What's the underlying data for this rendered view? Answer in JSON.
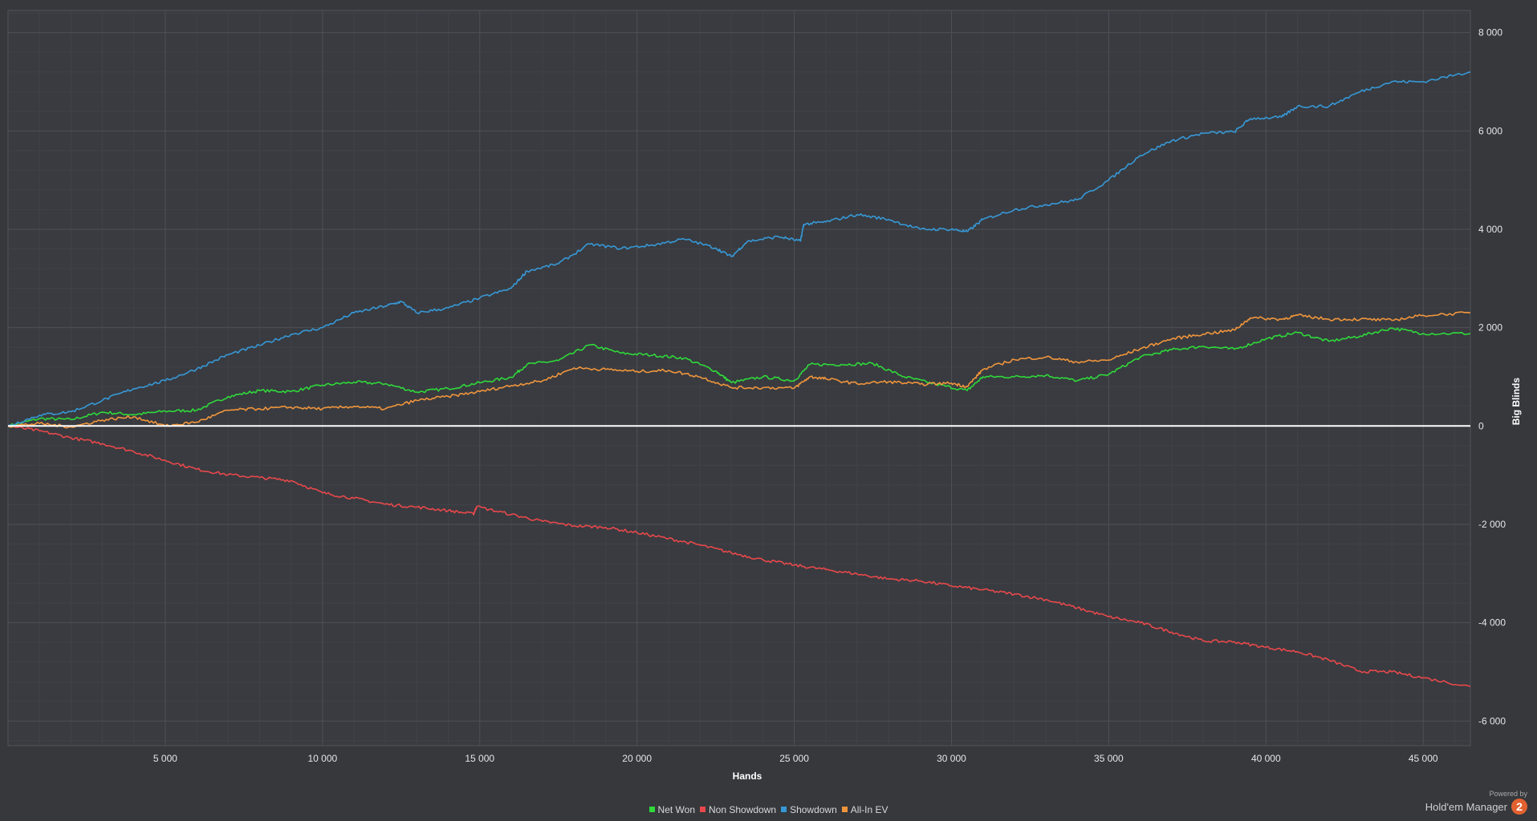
{
  "chart_data": {
    "type": "line",
    "title": "",
    "xlabel": "Hands",
    "ylabel": "Big Blinds",
    "xlim": [
      0,
      46500
    ],
    "ylim": [
      -6500,
      8450
    ],
    "x_ticks": [
      5000,
      10000,
      15000,
      20000,
      25000,
      30000,
      35000,
      40000,
      45000
    ],
    "x_tick_labels": [
      "5 000",
      "10 000",
      "15 000",
      "20 000",
      "25 000",
      "30 000",
      "35 000",
      "40 000",
      "45 000"
    ],
    "y_ticks": [
      -6000,
      -4000,
      -2000,
      0,
      2000,
      4000,
      6000,
      8000
    ],
    "y_tick_labels": [
      "-6 000",
      "-4 000",
      "-2 000",
      "0",
      "2 000",
      "4 000",
      "6 000",
      "8 000"
    ],
    "grid": true,
    "legend_position": "bottom-center",
    "series": [
      {
        "name": "Net Won",
        "color": "#2fd93a",
        "points": [
          [
            0,
            0
          ],
          [
            1000,
            150
          ],
          [
            2000,
            130
          ],
          [
            3000,
            280
          ],
          [
            4000,
            230
          ],
          [
            5000,
            300
          ],
          [
            6000,
            320
          ],
          [
            7000,
            600
          ],
          [
            8000,
            720
          ],
          [
            9000,
            700
          ],
          [
            10000,
            830
          ],
          [
            11000,
            890
          ],
          [
            12000,
            860
          ],
          [
            13000,
            690
          ],
          [
            14000,
            760
          ],
          [
            15000,
            880
          ],
          [
            16000,
            990
          ],
          [
            16500,
            1250
          ],
          [
            17500,
            1330
          ],
          [
            18500,
            1650
          ],
          [
            19500,
            1480
          ],
          [
            20500,
            1440
          ],
          [
            21500,
            1380
          ],
          [
            22500,
            1120
          ],
          [
            23000,
            880
          ],
          [
            24000,
            1000
          ],
          [
            25000,
            920
          ],
          [
            25500,
            1250
          ],
          [
            26500,
            1250
          ],
          [
            27500,
            1270
          ],
          [
            28500,
            1000
          ],
          [
            29500,
            850
          ],
          [
            30500,
            720
          ],
          [
            31000,
            1000
          ],
          [
            32000,
            1000
          ],
          [
            33000,
            1030
          ],
          [
            34000,
            920
          ],
          [
            35000,
            1050
          ],
          [
            36000,
            1400
          ],
          [
            37000,
            1550
          ],
          [
            38000,
            1620
          ],
          [
            39000,
            1560
          ],
          [
            40000,
            1770
          ],
          [
            41000,
            1900
          ],
          [
            42000,
            1720
          ],
          [
            43000,
            1830
          ],
          [
            44000,
            1990
          ],
          [
            45000,
            1880
          ],
          [
            46500,
            1880
          ]
        ]
      },
      {
        "name": "Non Showdown",
        "color": "#e8484b",
        "points": [
          [
            0,
            0
          ],
          [
            1000,
            -100
          ],
          [
            2000,
            -240
          ],
          [
            3000,
            -360
          ],
          [
            4000,
            -520
          ],
          [
            5000,
            -700
          ],
          [
            6000,
            -880
          ],
          [
            7000,
            -990
          ],
          [
            8000,
            -1050
          ],
          [
            9000,
            -1110
          ],
          [
            10000,
            -1360
          ],
          [
            11000,
            -1470
          ],
          [
            12000,
            -1590
          ],
          [
            13000,
            -1650
          ],
          [
            14000,
            -1720
          ],
          [
            14800,
            -1790
          ],
          [
            14900,
            -1640
          ],
          [
            16000,
            -1800
          ],
          [
            17000,
            -1940
          ],
          [
            18000,
            -2030
          ],
          [
            19000,
            -2060
          ],
          [
            20000,
            -2170
          ],
          [
            21000,
            -2290
          ],
          [
            22000,
            -2420
          ],
          [
            23000,
            -2580
          ],
          [
            24000,
            -2720
          ],
          [
            25000,
            -2830
          ],
          [
            26000,
            -2920
          ],
          [
            27000,
            -3010
          ],
          [
            28000,
            -3110
          ],
          [
            29000,
            -3150
          ],
          [
            30000,
            -3250
          ],
          [
            31000,
            -3330
          ],
          [
            32000,
            -3420
          ],
          [
            33000,
            -3530
          ],
          [
            34000,
            -3700
          ],
          [
            35000,
            -3880
          ],
          [
            36000,
            -4000
          ],
          [
            37000,
            -4190
          ],
          [
            38000,
            -4370
          ],
          [
            39000,
            -4390
          ],
          [
            40000,
            -4500
          ],
          [
            41000,
            -4590
          ],
          [
            42000,
            -4760
          ],
          [
            43000,
            -4990
          ],
          [
            44000,
            -5000
          ],
          [
            45000,
            -5120
          ],
          [
            46500,
            -5300
          ]
        ]
      },
      {
        "name": "Showdown",
        "color": "#3798d6",
        "points": [
          [
            0,
            0
          ],
          [
            1000,
            220
          ],
          [
            2000,
            290
          ],
          [
            3000,
            520
          ],
          [
            4000,
            760
          ],
          [
            5000,
            920
          ],
          [
            6000,
            1160
          ],
          [
            7000,
            1450
          ],
          [
            8000,
            1640
          ],
          [
            9000,
            1860
          ],
          [
            10000,
            2000
          ],
          [
            11000,
            2300
          ],
          [
            12000,
            2440
          ],
          [
            12500,
            2530
          ],
          [
            13000,
            2300
          ],
          [
            14000,
            2400
          ],
          [
            15000,
            2600
          ],
          [
            16000,
            2800
          ],
          [
            16500,
            3150
          ],
          [
            17500,
            3300
          ],
          [
            18500,
            3700
          ],
          [
            19500,
            3610
          ],
          [
            20500,
            3680
          ],
          [
            21500,
            3800
          ],
          [
            22500,
            3620
          ],
          [
            23000,
            3440
          ],
          [
            23500,
            3750
          ],
          [
            24500,
            3850
          ],
          [
            25200,
            3760
          ],
          [
            25300,
            4100
          ],
          [
            26000,
            4150
          ],
          [
            27000,
            4300
          ],
          [
            28000,
            4200
          ],
          [
            29000,
            4000
          ],
          [
            30000,
            4000
          ],
          [
            30500,
            3950
          ],
          [
            31000,
            4200
          ],
          [
            32000,
            4400
          ],
          [
            33000,
            4500
          ],
          [
            34000,
            4600
          ],
          [
            35000,
            5000
          ],
          [
            36000,
            5500
          ],
          [
            37000,
            5800
          ],
          [
            38000,
            5950
          ],
          [
            39000,
            5980
          ],
          [
            39500,
            6250
          ],
          [
            40500,
            6280
          ],
          [
            41000,
            6500
          ],
          [
            42000,
            6500
          ],
          [
            43000,
            6800
          ],
          [
            44000,
            7000
          ],
          [
            45000,
            7000
          ],
          [
            46500,
            7200
          ]
        ]
      },
      {
        "name": "All-In EV",
        "color": "#f0953c",
        "points": [
          [
            0,
            0
          ],
          [
            1000,
            50
          ],
          [
            2000,
            -20
          ],
          [
            3000,
            120
          ],
          [
            4000,
            190
          ],
          [
            5000,
            0
          ],
          [
            6000,
            80
          ],
          [
            7000,
            320
          ],
          [
            8000,
            350
          ],
          [
            9000,
            380
          ],
          [
            10000,
            350
          ],
          [
            11000,
            400
          ],
          [
            12000,
            350
          ],
          [
            13000,
            520
          ],
          [
            14000,
            600
          ],
          [
            15000,
            700
          ],
          [
            16000,
            820
          ],
          [
            17000,
            920
          ],
          [
            18000,
            1180
          ],
          [
            19000,
            1150
          ],
          [
            20000,
            1110
          ],
          [
            21000,
            1130
          ],
          [
            22000,
            1000
          ],
          [
            23000,
            780
          ],
          [
            24000,
            780
          ],
          [
            25000,
            770
          ],
          [
            25500,
            1000
          ],
          [
            26000,
            960
          ],
          [
            27000,
            860
          ],
          [
            28000,
            900
          ],
          [
            29000,
            850
          ],
          [
            30000,
            870
          ],
          [
            30500,
            800
          ],
          [
            31000,
            1150
          ],
          [
            32000,
            1350
          ],
          [
            33000,
            1400
          ],
          [
            34000,
            1300
          ],
          [
            35000,
            1340
          ],
          [
            36000,
            1570
          ],
          [
            37000,
            1770
          ],
          [
            38000,
            1870
          ],
          [
            39000,
            1950
          ],
          [
            39500,
            2200
          ],
          [
            40500,
            2170
          ],
          [
            41000,
            2250
          ],
          [
            42000,
            2170
          ],
          [
            43000,
            2170
          ],
          [
            44000,
            2150
          ],
          [
            45000,
            2250
          ],
          [
            46500,
            2300
          ]
        ]
      }
    ]
  },
  "branding": {
    "powered_by": "Powered by",
    "name": "Hold'em Manager",
    "badge": "2"
  }
}
